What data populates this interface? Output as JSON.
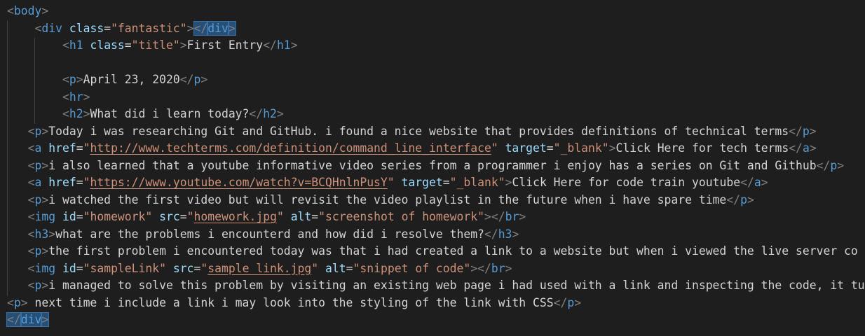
{
  "colors": {
    "background": "#1e1e1e",
    "punctuation": "#808080",
    "tag": "#569cd6",
    "attribute": "#9cdcfe",
    "string": "#ce9178",
    "text": "#d4d4d4",
    "highlight": "#264f78"
  },
  "editor": {
    "lines": [
      [
        {
          "t": "punc",
          "v": "<"
        },
        {
          "t": "tag",
          "v": "body"
        },
        {
          "t": "punc",
          "v": ">"
        }
      ],
      [
        {
          "t": "ws",
          "v": "    "
        },
        {
          "t": "punc",
          "v": "<"
        },
        {
          "t": "tag",
          "v": "div"
        },
        {
          "t": "ws",
          "v": " "
        },
        {
          "t": "attr",
          "v": "class"
        },
        {
          "t": "txt",
          "v": "="
        },
        {
          "t": "str",
          "v": "\"fantastic\""
        },
        {
          "t": "punc",
          "v": ">"
        },
        {
          "t": "punc",
          "v": "</",
          "hl": true
        },
        {
          "t": "tag",
          "v": "div",
          "hl": true
        },
        {
          "t": "punc",
          "v": ">",
          "hl": true
        }
      ],
      [
        {
          "t": "ws",
          "v": "        "
        },
        {
          "t": "punc",
          "v": "<"
        },
        {
          "t": "tag",
          "v": "h1"
        },
        {
          "t": "ws",
          "v": " "
        },
        {
          "t": "attr",
          "v": "class"
        },
        {
          "t": "txt",
          "v": "="
        },
        {
          "t": "str",
          "v": "\"title\""
        },
        {
          "t": "punc",
          "v": ">"
        },
        {
          "t": "txt",
          "v": "First Entry"
        },
        {
          "t": "punc",
          "v": "</"
        },
        {
          "t": "tag",
          "v": "h1"
        },
        {
          "t": "punc",
          "v": ">"
        }
      ],
      [],
      [
        {
          "t": "ws",
          "v": "        "
        },
        {
          "t": "punc",
          "v": "<"
        },
        {
          "t": "tag",
          "v": "p"
        },
        {
          "t": "punc",
          "v": ">"
        },
        {
          "t": "txt",
          "v": "April 23, 2020"
        },
        {
          "t": "punc",
          "v": "</"
        },
        {
          "t": "tag",
          "v": "p"
        },
        {
          "t": "punc",
          "v": ">"
        }
      ],
      [
        {
          "t": "ws",
          "v": "        "
        },
        {
          "t": "punc",
          "v": "<"
        },
        {
          "t": "tag",
          "v": "hr"
        },
        {
          "t": "punc",
          "v": ">"
        }
      ],
      [
        {
          "t": "ws",
          "v": "        "
        },
        {
          "t": "punc",
          "v": "<"
        },
        {
          "t": "tag",
          "v": "h2"
        },
        {
          "t": "punc",
          "v": ">"
        },
        {
          "t": "txt",
          "v": "What did i learn today?"
        },
        {
          "t": "punc",
          "v": "</"
        },
        {
          "t": "tag",
          "v": "h2"
        },
        {
          "t": "punc",
          "v": ">"
        }
      ],
      [
        {
          "t": "ws",
          "v": "   "
        },
        {
          "t": "punc",
          "v": "<"
        },
        {
          "t": "tag",
          "v": "p"
        },
        {
          "t": "punc",
          "v": ">"
        },
        {
          "t": "txt",
          "v": "Today i was researching Git and GitHub. i found a nice website that provides definitions of technical terms"
        },
        {
          "t": "punc",
          "v": "</"
        },
        {
          "t": "tag",
          "v": "p"
        },
        {
          "t": "punc",
          "v": ">"
        }
      ],
      [
        {
          "t": "ws",
          "v": "   "
        },
        {
          "t": "punc",
          "v": "<"
        },
        {
          "t": "tag",
          "v": "a"
        },
        {
          "t": "ws",
          "v": " "
        },
        {
          "t": "attr",
          "v": "href"
        },
        {
          "t": "txt",
          "v": "="
        },
        {
          "t": "str",
          "v": "\""
        },
        {
          "t": "link",
          "v": "http://www.techterms.com/definition/command_line_interface"
        },
        {
          "t": "str",
          "v": "\""
        },
        {
          "t": "ws",
          "v": " "
        },
        {
          "t": "attr",
          "v": "target"
        },
        {
          "t": "txt",
          "v": "="
        },
        {
          "t": "str",
          "v": "\"_blank\""
        },
        {
          "t": "punc",
          "v": ">"
        },
        {
          "t": "txt",
          "v": "Click Here for tech terms"
        },
        {
          "t": "punc",
          "v": "</"
        },
        {
          "t": "tag",
          "v": "a"
        },
        {
          "t": "punc",
          "v": ">"
        }
      ],
      [
        {
          "t": "ws",
          "v": "   "
        },
        {
          "t": "punc",
          "v": "<"
        },
        {
          "t": "tag",
          "v": "p"
        },
        {
          "t": "punc",
          "v": ">"
        },
        {
          "t": "txt",
          "v": "i also learned that a youtube informative video series from a programmer i enjoy has a series on Git and Github"
        },
        {
          "t": "punc",
          "v": "</"
        },
        {
          "t": "tag",
          "v": "p"
        },
        {
          "t": "punc",
          "v": ">"
        }
      ],
      [
        {
          "t": "ws",
          "v": "   "
        },
        {
          "t": "punc",
          "v": "<"
        },
        {
          "t": "tag",
          "v": "a"
        },
        {
          "t": "ws",
          "v": " "
        },
        {
          "t": "attr",
          "v": "href"
        },
        {
          "t": "txt",
          "v": "="
        },
        {
          "t": "str",
          "v": "\""
        },
        {
          "t": "link",
          "v": "https://www.youtube.com/watch?v=BCQHnlnPusY"
        },
        {
          "t": "str",
          "v": "\""
        },
        {
          "t": "ws",
          "v": " "
        },
        {
          "t": "attr",
          "v": "target"
        },
        {
          "t": "txt",
          "v": "="
        },
        {
          "t": "str",
          "v": "\"_blank\""
        },
        {
          "t": "punc",
          "v": ">"
        },
        {
          "t": "txt",
          "v": "Click Here for code train youtube"
        },
        {
          "t": "punc",
          "v": "</"
        },
        {
          "t": "tag",
          "v": "a"
        },
        {
          "t": "punc",
          "v": ">"
        }
      ],
      [
        {
          "t": "ws",
          "v": "   "
        },
        {
          "t": "punc",
          "v": "<"
        },
        {
          "t": "tag",
          "v": "p"
        },
        {
          "t": "punc",
          "v": ">"
        },
        {
          "t": "txt",
          "v": "i watched the first video but will revisit the video playlist in the future when i have spare time"
        },
        {
          "t": "punc",
          "v": "</"
        },
        {
          "t": "tag",
          "v": "p"
        },
        {
          "t": "punc",
          "v": ">"
        }
      ],
      [
        {
          "t": "ws",
          "v": "   "
        },
        {
          "t": "punc",
          "v": "<"
        },
        {
          "t": "tag",
          "v": "img"
        },
        {
          "t": "ws",
          "v": " "
        },
        {
          "t": "attr",
          "v": "id"
        },
        {
          "t": "txt",
          "v": "="
        },
        {
          "t": "str",
          "v": "\"homework\""
        },
        {
          "t": "ws",
          "v": " "
        },
        {
          "t": "attr",
          "v": "src"
        },
        {
          "t": "txt",
          "v": "="
        },
        {
          "t": "str",
          "v": "\""
        },
        {
          "t": "link",
          "v": "homework.jpg"
        },
        {
          "t": "str",
          "v": "\""
        },
        {
          "t": "ws",
          "v": " "
        },
        {
          "t": "attr",
          "v": "alt"
        },
        {
          "t": "txt",
          "v": "="
        },
        {
          "t": "str",
          "v": "\"screenshot of homework\""
        },
        {
          "t": "punc",
          "v": "></"
        },
        {
          "t": "tag",
          "v": "br"
        },
        {
          "t": "punc",
          "v": ">"
        }
      ],
      [
        {
          "t": "ws",
          "v": "   "
        },
        {
          "t": "punc",
          "v": "<"
        },
        {
          "t": "tag",
          "v": "h3"
        },
        {
          "t": "punc",
          "v": ">"
        },
        {
          "t": "txt",
          "v": "what are the problems i encounterd and how did i resolve them?"
        },
        {
          "t": "punc",
          "v": "</"
        },
        {
          "t": "tag",
          "v": "h3"
        },
        {
          "t": "punc",
          "v": ">"
        }
      ],
      [
        {
          "t": "ws",
          "v": "   "
        },
        {
          "t": "punc",
          "v": "<"
        },
        {
          "t": "tag",
          "v": "p"
        },
        {
          "t": "punc",
          "v": ">"
        },
        {
          "t": "txt",
          "v": "the first problem i encountered today was that i had created a link to a website but when i viewed the live server co"
        }
      ],
      [
        {
          "t": "ws",
          "v": "   "
        },
        {
          "t": "punc",
          "v": "<"
        },
        {
          "t": "tag",
          "v": "img"
        },
        {
          "t": "ws",
          "v": " "
        },
        {
          "t": "attr",
          "v": "id"
        },
        {
          "t": "txt",
          "v": "="
        },
        {
          "t": "str",
          "v": "\"sampleLink\""
        },
        {
          "t": "ws",
          "v": " "
        },
        {
          "t": "attr",
          "v": "src"
        },
        {
          "t": "txt",
          "v": "="
        },
        {
          "t": "str",
          "v": "\""
        },
        {
          "t": "link",
          "v": "sample link.jpg"
        },
        {
          "t": "str",
          "v": "\""
        },
        {
          "t": "ws",
          "v": " "
        },
        {
          "t": "attr",
          "v": "alt"
        },
        {
          "t": "txt",
          "v": "="
        },
        {
          "t": "str",
          "v": "\"snippet of code\""
        },
        {
          "t": "punc",
          "v": "></"
        },
        {
          "t": "tag",
          "v": "br"
        },
        {
          "t": "punc",
          "v": ">"
        }
      ],
      [
        {
          "t": "ws",
          "v": "   "
        },
        {
          "t": "punc",
          "v": "<"
        },
        {
          "t": "tag",
          "v": "p"
        },
        {
          "t": "punc",
          "v": ">"
        },
        {
          "t": "txt",
          "v": "i managed to solve this problem by visiting an existing web page i had used with a link and inspecting the code, it tu"
        }
      ],
      [
        {
          "t": "punc",
          "v": "<"
        },
        {
          "t": "tag",
          "v": "p"
        },
        {
          "t": "punc",
          "v": ">"
        },
        {
          "t": "txt",
          "v": " next time i include a link i may look into the styling of the link with CSS"
        },
        {
          "t": "punc",
          "v": "</"
        },
        {
          "t": "tag",
          "v": "p"
        },
        {
          "t": "punc",
          "v": ">"
        }
      ],
      [
        {
          "t": "punc",
          "v": "</",
          "hl": true
        },
        {
          "t": "tag",
          "v": "div",
          "hl": true
        },
        {
          "t": "punc",
          "v": ">",
          "hl": true
        }
      ]
    ]
  }
}
